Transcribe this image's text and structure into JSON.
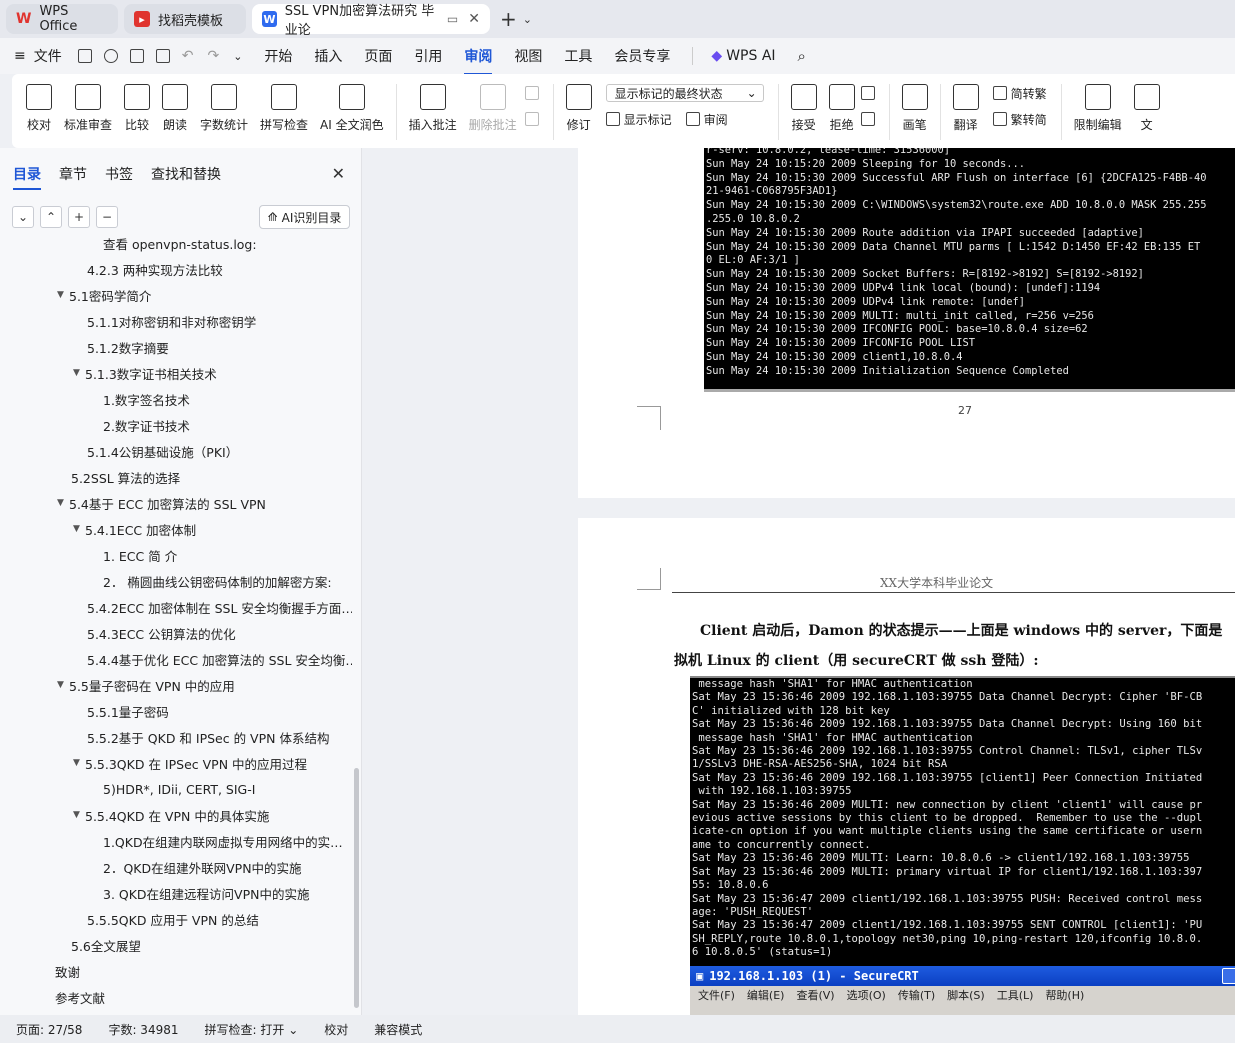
{
  "tabs": [
    {
      "label": "WPS Office",
      "icon": "wps-logo-icon"
    },
    {
      "label": "找稻壳模板",
      "icon": "docer-icon"
    },
    {
      "label": "SSL VPN加密算法研究 毕业论",
      "icon": "writer-icon"
    }
  ],
  "menu": {
    "file": "文件",
    "items": [
      "开始",
      "插入",
      "页面",
      "引用",
      "审阅",
      "视图",
      "工具",
      "会员专享"
    ],
    "active": "审阅",
    "wps_ai": "WPS AI"
  },
  "ribbon": {
    "proof": "校对",
    "std_review": "标准审查",
    "compare": "比较",
    "read_aloud": "朗读",
    "word_count": "字数统计",
    "spell_check": "拼写检查",
    "ai_polish": "AI 全文润色",
    "insert_comment": "插入批注",
    "delete_comment": "删除批注",
    "revise": "修订",
    "markup_dropdown": "显示标记的最终状态",
    "show_markup": "显示标记",
    "review": "审阅",
    "accept": "接受",
    "reject": "拒绝",
    "pen": "画笔",
    "translate": "翻译",
    "to_traditional": "简转繁",
    "to_simplified": "繁转简",
    "restrict_edit": "限制编辑",
    "last": "文"
  },
  "panel": {
    "tabs": [
      "目录",
      "章节",
      "书签",
      "查找和替换"
    ],
    "ai_toc": "AI识别目录",
    "toc": [
      {
        "text": "查看 openvpn-status.log:",
        "level": 3,
        "arrow": ""
      },
      {
        "text": "4.2.3 两种实现方法比较",
        "level": 2,
        "arrow": ""
      },
      {
        "text": "5.1密码学简介",
        "level": 1,
        "arrow": "▼"
      },
      {
        "text": "5.1.1对称密钥和非对称密钥学",
        "level": 2,
        "arrow": ""
      },
      {
        "text": "5.1.2数字摘要",
        "level": 2,
        "arrow": ""
      },
      {
        "text": "5.1.3数字证书相关技术",
        "level": 2,
        "arrow": "▼"
      },
      {
        "text": "1.数字签名技术",
        "level": 3,
        "arrow": ""
      },
      {
        "text": "2.数字证书技术",
        "level": 3,
        "arrow": ""
      },
      {
        "text": "5.1.4公钥基础设施（PKI）",
        "level": 2,
        "arrow": ""
      },
      {
        "text": "5.2SSL 算法的选择",
        "level": 1,
        "arrow": ""
      },
      {
        "text": "5.4基于 ECC 加密算法的 SSL VPN",
        "level": 1,
        "arrow": "▼"
      },
      {
        "text": "5.4.1ECC 加密体制",
        "level": 2,
        "arrow": "▼"
      },
      {
        "text": "1. ECC 简 介",
        "level": 3,
        "arrow": ""
      },
      {
        "text": "2．  椭圆曲线公钥密码体制的加解密方案:",
        "level": 3,
        "arrow": ""
      },
      {
        "text": "5.4.2ECC 加密体制在 SSL 安全均衡握手方面…",
        "level": 2,
        "arrow": ""
      },
      {
        "text": "5.4.3ECC 公钥算法的优化",
        "level": 2,
        "arrow": ""
      },
      {
        "text": "5.4.4基于优化 ECC 加密算法的 SSL 安全均衡…",
        "level": 2,
        "arrow": ""
      },
      {
        "text": "5.5量子密码在 VPN 中的应用",
        "level": 1,
        "arrow": "▼"
      },
      {
        "text": "5.5.1量子密码",
        "level": 2,
        "arrow": ""
      },
      {
        "text": "5.5.2基于 QKD 和 IPSec 的 VPN 体系结构",
        "level": 2,
        "arrow": ""
      },
      {
        "text": "5.5.3QKD 在 IPSec VPN 中的应用过程",
        "level": 2,
        "arrow": "▼"
      },
      {
        "text": "5)HDR*, IDii, CERT, SIG-I",
        "level": 3,
        "arrow": ""
      },
      {
        "text": "5.5.4QKD 在 VPN 中的具体实施",
        "level": 2,
        "arrow": "▼"
      },
      {
        "text": "1.QKD在组建内联网虚拟专用网络中的实…",
        "level": 3,
        "arrow": ""
      },
      {
        "text": "2．QKD在组建外联网VPN中的实施",
        "level": 3,
        "arrow": ""
      },
      {
        "text": "3. QKD在组建远程访问VPN中的实施",
        "level": 3,
        "arrow": ""
      },
      {
        "text": "5.5.5QKD 应用于 VPN 的总结",
        "level": 2,
        "arrow": ""
      },
      {
        "text": "5.6全文展望",
        "level": 1,
        "arrow": ""
      },
      {
        "text": "致谢",
        "level": 0,
        "arrow": ""
      },
      {
        "text": "参考文献",
        "level": 0,
        "arrow": ""
      }
    ]
  },
  "doc": {
    "term1": "r-serv: 10.8.0.2, lease-time: 31536000]\nSun May 24 10:15:20 2009 Sleeping for 10 seconds...\nSun May 24 10:15:30 2009 Successful ARP Flush on interface [6] {2DCFA125-F4BB-40\n21-9461-C068795F3AD1}\nSun May 24 10:15:30 2009 C:\\WINDOWS\\system32\\route.exe ADD 10.8.0.0 MASK 255.255\n.255.0 10.8.0.2\nSun May 24 10:15:30 2009 Route addition via IPAPI succeeded [adaptive]\nSun May 24 10:15:30 2009 Data Channel MTU parms [ L:1542 D:1450 EF:42 EB:135 ET\n0 EL:0 AF:3/1 ]\nSun May 24 10:15:30 2009 Socket Buffers: R=[8192->8192] S=[8192->8192]\nSun May 24 10:15:30 2009 UDPv4 link local (bound): [undef]:1194\nSun May 24 10:15:30 2009 UDPv4 link remote: [undef]\nSun May 24 10:15:30 2009 MULTI: multi_init called, r=256 v=256\nSun May 24 10:15:30 2009 IFCONFIG POOL: base=10.8.0.4 size=62\nSun May 24 10:15:30 2009 IFCONFIG POOL LIST\nSun May 24 10:15:30 2009 client1,10.8.0.4\nSun May 24 10:15:30 2009 Initialization Sequence Completed",
    "page_number": "27",
    "header": "XX大学本科毕业论文",
    "para_line1": "Client 启动后，Damon 的状态提示——上面是 windows 中的 server，下面是",
    "para_line2": "拟机 Linux 的 client（用 secureCRT 做 ssh 登陆）:",
    "term2": " message hash 'SHA1' for HMAC authentication\nSat May 23 15:36:46 2009 192.168.1.103:39755 Data Channel Decrypt: Cipher 'BF-CB\nC' initialized with 128 bit key\nSat May 23 15:36:46 2009 192.168.1.103:39755 Data Channel Decrypt: Using 160 bit\n message hash 'SHA1' for HMAC authentication\nSat May 23 15:36:46 2009 192.168.1.103:39755 Control Channel: TLSv1, cipher TLSv\n1/SSLv3 DHE-RSA-AES256-SHA, 1024 bit RSA\nSat May 23 15:36:46 2009 192.168.1.103:39755 [client1] Peer Connection Initiated\n with 192.168.1.103:39755\nSat May 23 15:36:46 2009 MULTI: new connection by client 'client1' will cause pr\nevious active sessions by this client to be dropped.  Remember to use the --dupl\nicate-cn option if you want multiple clients using the same certificate or usern\name to concurrently connect.\nSat May 23 15:36:46 2009 MULTI: Learn: 10.8.0.6 -> client1/192.168.1.103:39755\nSat May 23 15:36:46 2009 MULTI: primary virtual IP for client1/192.168.1.103:397\n55: 10.8.0.6\nSat May 23 15:36:47 2009 client1/192.168.1.103:39755 PUSH: Received control mess\nage: 'PUSH_REQUEST'\nSat May 23 15:36:47 2009 client1/192.168.1.103:39755 SENT CONTROL [client1]: 'PU\nSH_REPLY,route 10.8.0.1,topology net30,ping 10,ping-restart 120,ifconfig 10.8.0.\n6 10.8.0.5' (status=1)",
    "crt_title": "192.168.1.103 (1) - SecureCRT",
    "crt_menu": [
      "文件(F)",
      "编辑(E)",
      "查看(V)",
      "选项(O)",
      "传输(T)",
      "脚本(S)",
      "工具(L)",
      "帮助(H)"
    ]
  },
  "status": {
    "page": "页面: 27/58",
    "words": "字数: 34981",
    "spell": "拼写检查: 打开",
    "proof": "校对",
    "compat": "兼容模式"
  }
}
